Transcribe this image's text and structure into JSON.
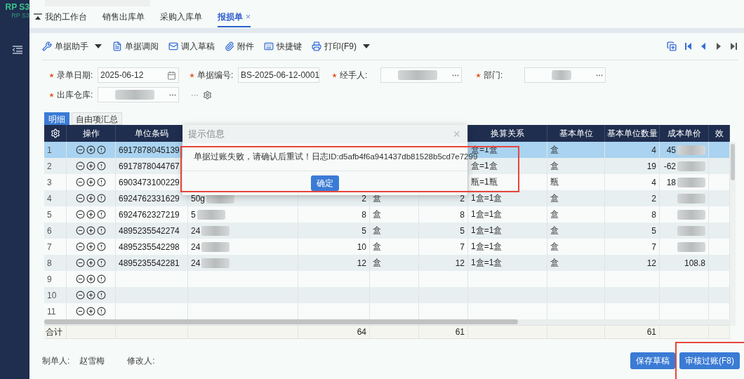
{
  "sidebar": {
    "logo": "RP S3",
    "logo_sub": "RP S3"
  },
  "tabs": [
    {
      "label": "我的工作台",
      "selected": false
    },
    {
      "label": "销售出库单",
      "selected": false
    },
    {
      "label": "采购入库单",
      "selected": false
    },
    {
      "label": "报损单",
      "selected": true,
      "close": "×"
    }
  ],
  "toolbar": [
    {
      "label": "单据助手",
      "dropdown": true
    },
    {
      "label": "单据调阅",
      "dropdown": false
    },
    {
      "label": "调入草稿",
      "dropdown": false
    },
    {
      "label": "附件",
      "dropdown": false
    },
    {
      "label": "快捷键",
      "dropdown": false
    },
    {
      "label": "打印(F9)",
      "dropdown": true
    }
  ],
  "form": {
    "fields": [
      {
        "label": "录单日期:",
        "required": true,
        "kind": "date",
        "value": "2025-06-12"
      },
      {
        "label": "单据编号:",
        "required": true,
        "kind": "text",
        "value": "BS-2025-06-12-0001"
      },
      {
        "label": "经手人:",
        "required": true,
        "kind": "picker",
        "redacted": true
      },
      {
        "label": "部门:",
        "required": true,
        "kind": "picker",
        "redacted": true
      },
      {
        "label": "出库仓库:",
        "required": true,
        "kind": "picker",
        "redacted": true
      }
    ],
    "more": "···"
  },
  "detail_tabs": [
    {
      "label": "明细",
      "selected": true
    },
    {
      "label": "自由项汇总",
      "selected": false
    }
  ],
  "table": {
    "columns": [
      {
        "label": "操作"
      },
      {
        "label": "单位条码"
      },
      {},
      {},
      {},
      {},
      {
        "label": "换算关系"
      },
      {
        "label": "基本单位"
      },
      {
        "label": "基本单位数量"
      },
      {
        "label": "成本单价"
      },
      {
        "label": "效"
      }
    ],
    "rows": [
      {
        "no": "1",
        "selected": true,
        "cells": [
          {
            "kind": "actions"
          },
          "6917878045139",
          null,
          null,
          null,
          null,
          "盒=1盒",
          "盒",
          "4",
          {
            "text": "45",
            "redacted": true
          },
          null
        ]
      },
      {
        "no": "2",
        "selected": false,
        "cells": [
          {
            "kind": "actions"
          },
          "6917878044767",
          null,
          null,
          null,
          null,
          "盒=1盒",
          "盒",
          "19",
          {
            "text": "-62",
            "redacted": true
          },
          null
        ]
      },
      {
        "no": "3",
        "selected": false,
        "cells": [
          {
            "kind": "actions"
          },
          "6903473100229",
          null,
          null,
          null,
          null,
          "瓶=1瓶",
          "瓶",
          "4",
          {
            "text": "18",
            "redacted": true
          },
          null
        ]
      },
      {
        "no": "4",
        "selected": false,
        "cells": [
          {
            "kind": "actions"
          },
          "6924762331629",
          {
            "text": "50g",
            "redacted": true
          },
          "2",
          "盒",
          "2",
          "1盒=1盒",
          "盒",
          "2",
          {
            "redacted": true
          },
          null
        ]
      },
      {
        "no": "5",
        "selected": false,
        "cells": [
          {
            "kind": "actions"
          },
          "6924762327219",
          {
            "text": "5",
            "redacted": true
          },
          "8",
          "盒",
          "8",
          "1盒=1盒",
          "盒",
          "8",
          {
            "redacted": true
          },
          null
        ]
      },
      {
        "no": "6",
        "selected": false,
        "cells": [
          {
            "kind": "actions"
          },
          "4895235542274",
          {
            "text": "24",
            "redacted": true
          },
          "5",
          "盒",
          "5",
          "1盒=1盒",
          "盒",
          "5",
          {
            "redacted": true
          },
          null
        ]
      },
      {
        "no": "7",
        "selected": false,
        "cells": [
          {
            "kind": "actions"
          },
          "4895235542298",
          {
            "text": "24",
            "redacted": true
          },
          "10",
          "盒",
          "7",
          "1盒=1盒",
          "盒",
          "7",
          {
            "redacted": true
          },
          null
        ]
      },
      {
        "no": "8",
        "selected": false,
        "cells": [
          {
            "kind": "actions"
          },
          "4895235542281",
          {
            "text": "24",
            "redacted": true
          },
          "12",
          "盒",
          "12",
          "1盒=1盒",
          "盒",
          "12",
          "108.8",
          null
        ]
      },
      {
        "no": "9",
        "selected": false,
        "cells": [
          {
            "kind": "actions"
          },
          null,
          null,
          null,
          null,
          null,
          null,
          null,
          null,
          null,
          null
        ]
      },
      {
        "no": "10",
        "selected": false,
        "cells": [
          {
            "kind": "actions"
          },
          null,
          null,
          null,
          null,
          null,
          null,
          null,
          null,
          null,
          null
        ]
      },
      {
        "no": "11",
        "selected": false,
        "cells": [
          {
            "kind": "actions"
          },
          null,
          null,
          null,
          null,
          null,
          null,
          null,
          null,
          null,
          null
        ]
      }
    ],
    "totals": {
      "label": "合计",
      "cells": [
        null,
        null,
        null,
        "64",
        null,
        "61",
        null,
        null,
        "61",
        null,
        null
      ]
    }
  },
  "dialog": {
    "title": "提示信息",
    "close": "×",
    "message": "单据过账失败，请确认后重试！日志ID:d5afb4f6a941437db81528b5cd7e7299",
    "button": "确定"
  },
  "footer": {
    "creator_label": "制单人:",
    "creator": "赵雪梅",
    "editor_label": "修改人:",
    "buttons": [
      "保存草稿",
      "审核过账(F8)"
    ]
  }
}
